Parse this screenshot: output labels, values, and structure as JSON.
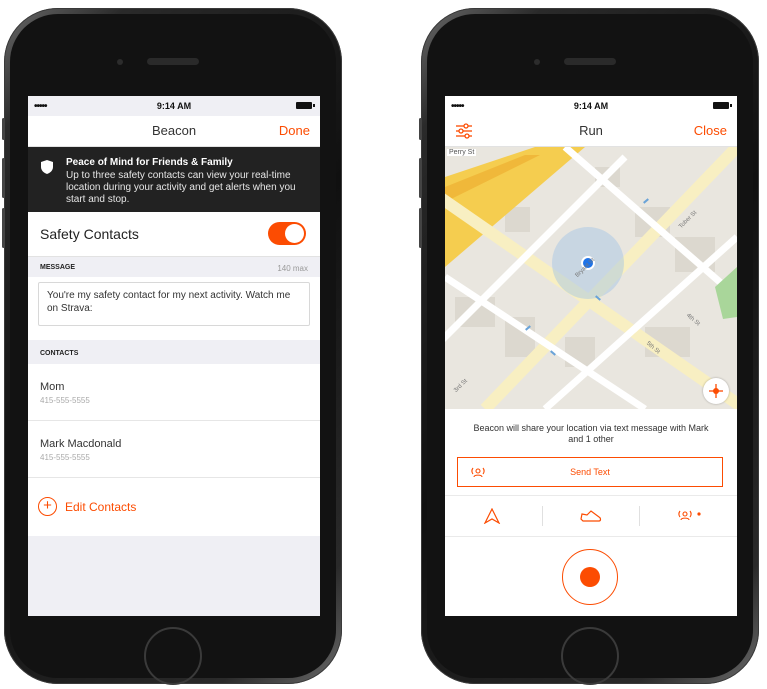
{
  "left_phone": {
    "status": {
      "signal": "•••••",
      "time": "9:14 AM"
    },
    "nav": {
      "title": "Beacon",
      "done": "Done"
    },
    "banner": {
      "title": "Peace of Mind for Friends & Family",
      "body": "Up to three safety contacts can view your real-time location during your activity and get alerts when you start and stop."
    },
    "safety": {
      "label": "Safety Contacts",
      "enabled": true
    },
    "message": {
      "header": "MESSAGE",
      "max": "140 max",
      "text": "You're my safety contact for my next activity. Watch me on Strava:"
    },
    "contacts": {
      "header": "CONTACTS",
      "items": [
        {
          "name": "Mom",
          "phone": "415-555-5555"
        },
        {
          "name": "Mark Macdonald",
          "phone": "415-555-5555"
        }
      ]
    },
    "edit": {
      "label": "Edit Contacts"
    }
  },
  "right_phone": {
    "status": {
      "signal": "•••••",
      "time": "9:14 AM"
    },
    "nav": {
      "title": "Run",
      "close": "Close"
    },
    "map": {
      "labels": {
        "perry": "Perry St",
        "bryant": "Bryant St",
        "third": "3rd St",
        "fifth": "5th St",
        "fourth": "4th St",
        "tober": "Tober St"
      }
    },
    "info": {
      "message": "Beacon will share your location via text message with Mark and 1 other",
      "send": "Send Text"
    }
  },
  "colors": {
    "accent": "#fc4c02",
    "banner_bg": "#222222",
    "screen_bg": "#efeff4"
  }
}
